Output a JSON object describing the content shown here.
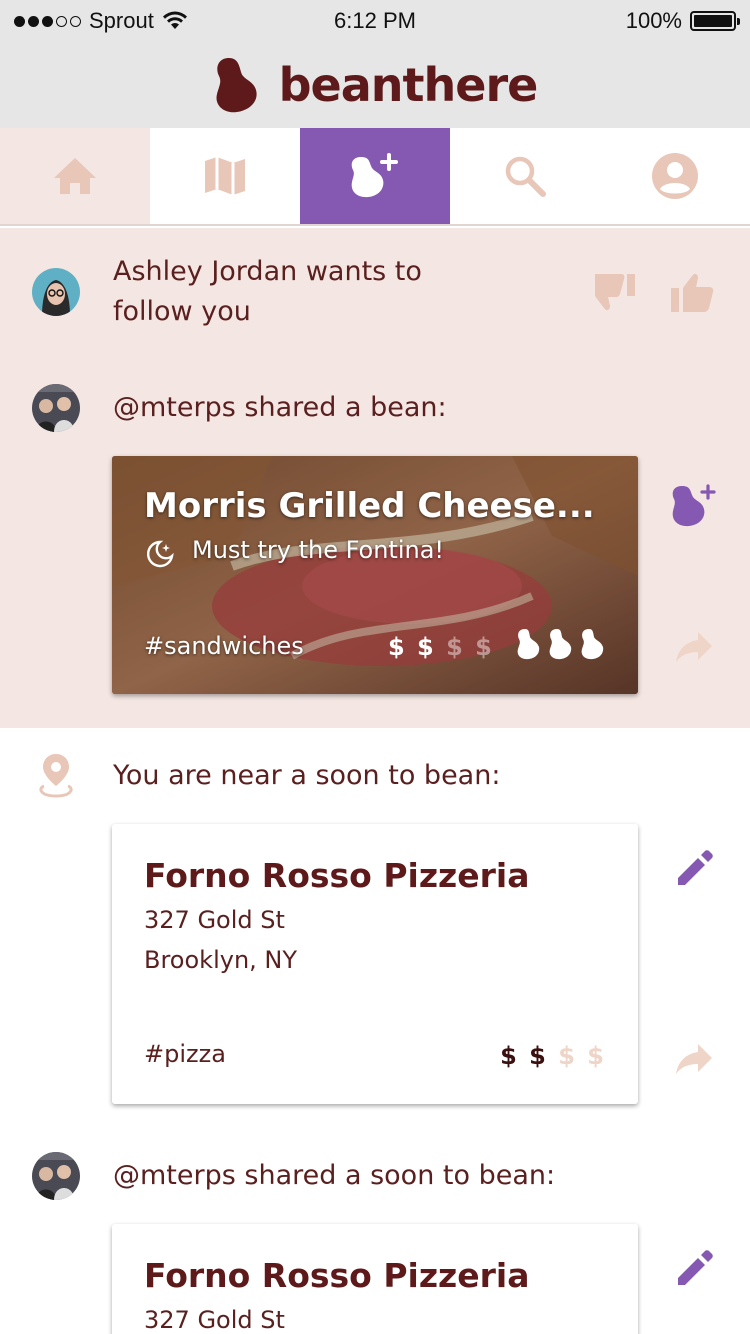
{
  "status_bar": {
    "carrier": "Sprout",
    "time": "6:12 PM",
    "battery": "100%"
  },
  "header": {
    "app_name": "beanthere"
  },
  "tabs": [
    {
      "name": "home",
      "icon": "home-icon"
    },
    {
      "name": "map",
      "icon": "map-icon"
    },
    {
      "name": "add-bean",
      "icon": "add-bean-icon",
      "active": true
    },
    {
      "name": "search",
      "icon": "search-icon"
    },
    {
      "name": "profile",
      "icon": "profile-icon"
    }
  ],
  "colors": {
    "accent": "#8559b1",
    "brand": "#5e1a1a",
    "tint": "#f4e6e2",
    "muted_icon": "#e8c6b8"
  },
  "feed": {
    "follow_request": {
      "name": "Ashley Jordan",
      "text": "wants to",
      "text2": "follow you"
    },
    "shared_bean": {
      "user": "@mterps",
      "text": "shared a bean:",
      "card": {
        "title": "Morris Grilled Cheese...",
        "note": "Must try the Fontina!",
        "tag": "#sandwiches",
        "price_on": "$ $",
        "price_off": "$ $",
        "bean_rating": 3
      }
    },
    "nearby": {
      "text": "You are near a soon to bean:",
      "card": {
        "title": "Forno Rosso Pizzeria",
        "address_line1": "327 Gold St",
        "address_line2": "Brooklyn, NY",
        "tag": "#pizza",
        "price_on": "$ $",
        "price_off": "$ $"
      }
    },
    "shared_soon": {
      "user": "@mterps",
      "text": "shared a soon to bean:",
      "card": {
        "title": "Forno Rosso Pizzeria",
        "address_line1": "327 Gold St"
      }
    }
  }
}
